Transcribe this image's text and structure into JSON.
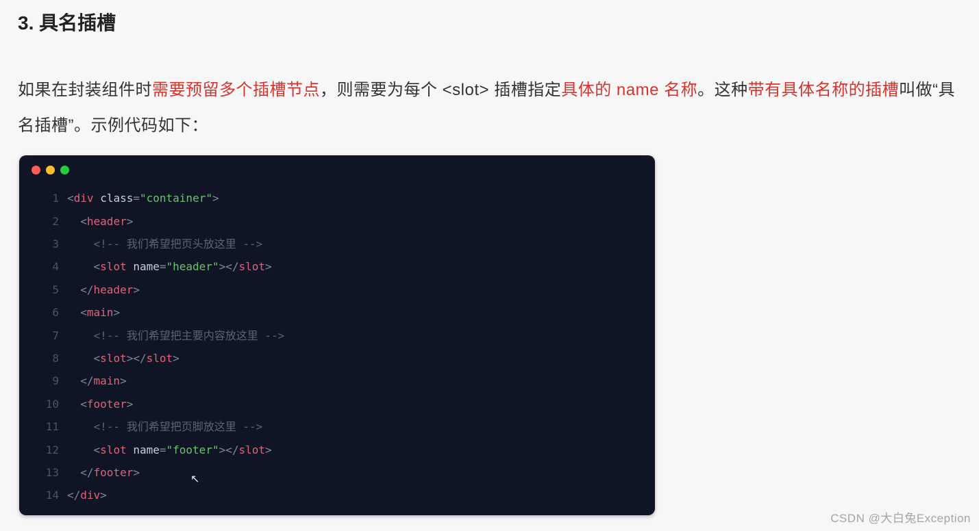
{
  "section": {
    "title": "3. 具名插槽"
  },
  "intro": {
    "seg1": "如果在封装组件时",
    "hl1": "需要预留多个插槽节点",
    "seg2": "，则需要为每个 <slot> 插槽指定",
    "hl2": "具体的 name 名称",
    "seg3": "。这种",
    "hl3": "带有具体名称的插槽",
    "seg4": "叫做“具名插槽”。示例代码如下："
  },
  "code": {
    "lines": [
      {
        "n": "1",
        "tokens": [
          [
            "punc",
            "<"
          ],
          [
            "tag",
            "div"
          ],
          [
            "plain",
            " "
          ],
          [
            "attr",
            "class"
          ],
          [
            "eq",
            "="
          ],
          [
            "str",
            "\"container\""
          ],
          [
            "punc",
            ">"
          ]
        ]
      },
      {
        "n": "2",
        "tokens": [
          [
            "plain",
            "  "
          ],
          [
            "punc",
            "<"
          ],
          [
            "tag",
            "header"
          ],
          [
            "punc",
            ">"
          ]
        ]
      },
      {
        "n": "3",
        "tokens": [
          [
            "plain",
            "    "
          ],
          [
            "cmt",
            "<!-- 我们希望把页头放这里 -->"
          ]
        ]
      },
      {
        "n": "4",
        "tokens": [
          [
            "plain",
            "    "
          ],
          [
            "punc",
            "<"
          ],
          [
            "tag",
            "slot"
          ],
          [
            "plain",
            " "
          ],
          [
            "attr",
            "name"
          ],
          [
            "eq",
            "="
          ],
          [
            "str",
            "\"header\""
          ],
          [
            "punc",
            ">"
          ],
          [
            "punc",
            "</"
          ],
          [
            "tag",
            "slot"
          ],
          [
            "punc",
            ">"
          ]
        ]
      },
      {
        "n": "5",
        "tokens": [
          [
            "plain",
            "  "
          ],
          [
            "punc",
            "</"
          ],
          [
            "tag",
            "header"
          ],
          [
            "punc",
            ">"
          ]
        ]
      },
      {
        "n": "6",
        "tokens": [
          [
            "plain",
            "  "
          ],
          [
            "punc",
            "<"
          ],
          [
            "tag",
            "main"
          ],
          [
            "punc",
            ">"
          ]
        ]
      },
      {
        "n": "7",
        "tokens": [
          [
            "plain",
            "    "
          ],
          [
            "cmt",
            "<!-- 我们希望把主要内容放这里 -->"
          ]
        ]
      },
      {
        "n": "8",
        "tokens": [
          [
            "plain",
            "    "
          ],
          [
            "punc",
            "<"
          ],
          [
            "tag",
            "slot"
          ],
          [
            "punc",
            ">"
          ],
          [
            "punc",
            "</"
          ],
          [
            "tag",
            "slot"
          ],
          [
            "punc",
            ">"
          ]
        ]
      },
      {
        "n": "9",
        "tokens": [
          [
            "plain",
            "  "
          ],
          [
            "punc",
            "</"
          ],
          [
            "tag",
            "main"
          ],
          [
            "punc",
            ">"
          ]
        ]
      },
      {
        "n": "10",
        "tokens": [
          [
            "plain",
            "  "
          ],
          [
            "punc",
            "<"
          ],
          [
            "tag",
            "footer"
          ],
          [
            "punc",
            ">"
          ]
        ]
      },
      {
        "n": "11",
        "tokens": [
          [
            "plain",
            "    "
          ],
          [
            "cmt",
            "<!-- 我们希望把页脚放这里 -->"
          ]
        ]
      },
      {
        "n": "12",
        "tokens": [
          [
            "plain",
            "    "
          ],
          [
            "punc",
            "<"
          ],
          [
            "tag",
            "slot"
          ],
          [
            "plain",
            " "
          ],
          [
            "attr",
            "name"
          ],
          [
            "eq",
            "="
          ],
          [
            "str",
            "\"footer\""
          ],
          [
            "punc",
            ">"
          ],
          [
            "punc",
            "</"
          ],
          [
            "tag",
            "slot"
          ],
          [
            "punc",
            ">"
          ]
        ]
      },
      {
        "n": "13",
        "tokens": [
          [
            "plain",
            "  "
          ],
          [
            "punc",
            "</"
          ],
          [
            "tag",
            "footer"
          ],
          [
            "punc",
            ">"
          ]
        ]
      },
      {
        "n": "14",
        "tokens": [
          [
            "punc",
            "</"
          ],
          [
            "tag",
            "div"
          ],
          [
            "punc",
            ">"
          ]
        ]
      }
    ]
  },
  "watermark": "CSDN @大白兔Exception"
}
